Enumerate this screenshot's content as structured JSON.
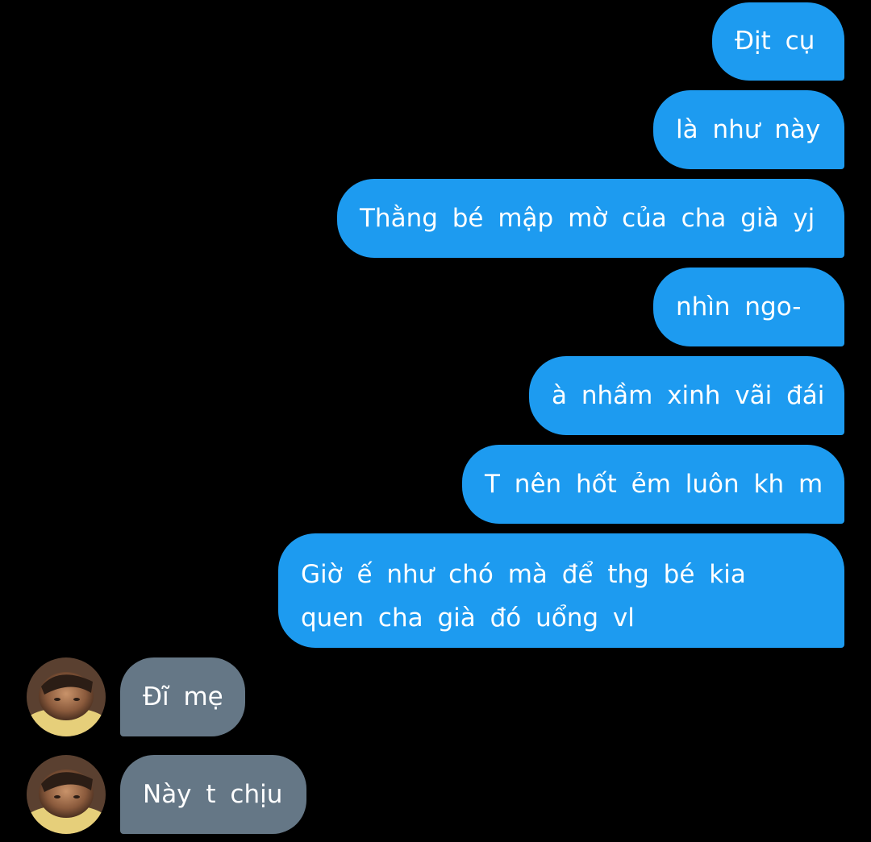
{
  "conversation": {
    "outgoing": [
      "Địt cụ",
      "là như này",
      "Thằng bé mập mờ của cha già yj",
      "nhìn ngo-",
      "à nhầm xinh vãi đái",
      "T nên hốt ẻm luôn kh m",
      "Giờ ế như chó mà để thg bé kia\nquen cha già đó uổng vl"
    ],
    "incoming": [
      "Đĩ mẹ",
      "Này t chịu"
    ]
  },
  "colors": {
    "background": "#000000",
    "outgoing_bubble": "#1d9bf0",
    "incoming_bubble": "#657786",
    "text": "#ffffff"
  },
  "icons": {
    "avatar": "contact-avatar-photo"
  }
}
